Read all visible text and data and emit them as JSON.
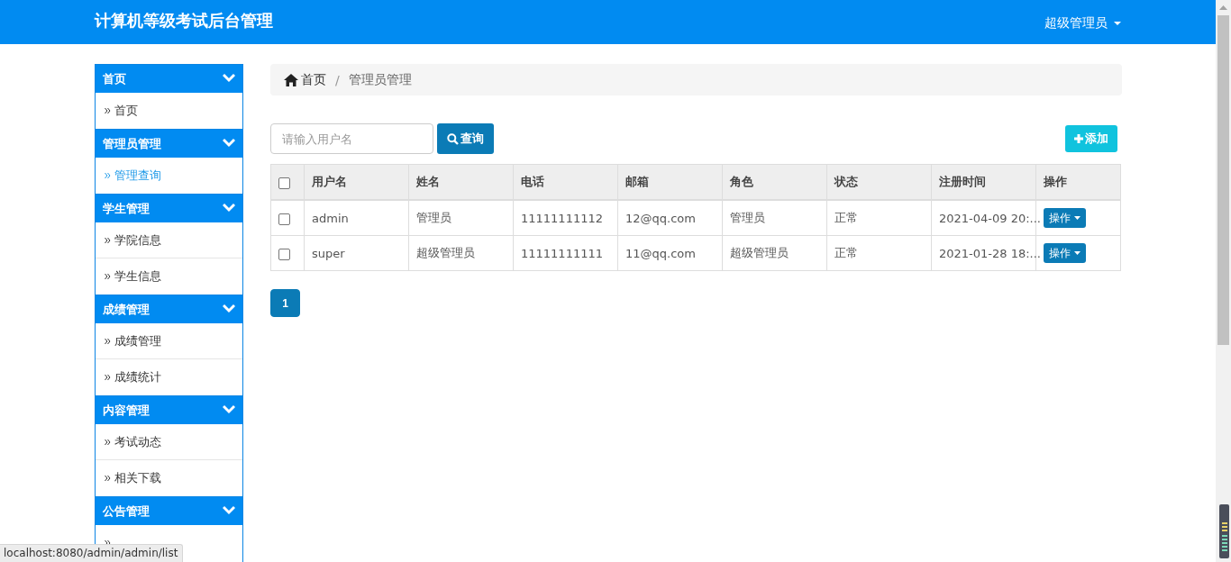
{
  "header": {
    "title": "计算机等级考试后台管理",
    "user": "超级管理员"
  },
  "sidebar": {
    "groups": [
      {
        "title": "首页",
        "expanded": true,
        "items": [
          {
            "label": "首页",
            "selected": false
          }
        ]
      },
      {
        "title": "管理员管理",
        "expanded": true,
        "items": [
          {
            "label": "管理查询",
            "selected": true
          }
        ]
      },
      {
        "title": "学生管理",
        "expanded": true,
        "items": [
          {
            "label": "学院信息",
            "selected": false
          },
          {
            "label": "学生信息",
            "selected": false
          }
        ]
      },
      {
        "title": "成绩管理",
        "expanded": true,
        "items": [
          {
            "label": "成绩管理",
            "selected": false
          },
          {
            "label": "成绩统计",
            "selected": false
          }
        ]
      },
      {
        "title": "内容管理",
        "expanded": true,
        "items": [
          {
            "label": "考试动态",
            "selected": false
          },
          {
            "label": "相关下载",
            "selected": false
          }
        ]
      },
      {
        "title": "公告管理",
        "expanded": true,
        "items": [
          {
            "selected": false
          }
        ]
      }
    ]
  },
  "breadcrumb": {
    "separator": "/",
    "items": [
      "首页",
      "管理员管理"
    ]
  },
  "search": {
    "placeholder": "请输入用户名",
    "button": "查询"
  },
  "add_button": "添加",
  "table": {
    "select_all": {
      "checked": false
    },
    "columns": [
      "用户名",
      "姓名",
      "电话",
      "邮箱",
      "角色",
      "状态",
      "注册时间",
      "操作"
    ],
    "rows": [
      {
        "checked": false,
        "cells": [
          "admin",
          "管理员",
          "11111111112",
          "12@qq.com",
          "管理员",
          "正常",
          "2021-04-09 20:..."
        ],
        "action": "操作"
      },
      {
        "checked": false,
        "cells": [
          "super",
          "超级管理员",
          "11111111111",
          "11@qq.com",
          "超级管理员",
          "正常",
          "2021-01-28 18:..."
        ],
        "action": "操作"
      }
    ]
  },
  "pagination": [
    {
      "label": "1",
      "selected": true
    }
  ],
  "status_bar": "localhost:8080/admin/admin/list"
}
